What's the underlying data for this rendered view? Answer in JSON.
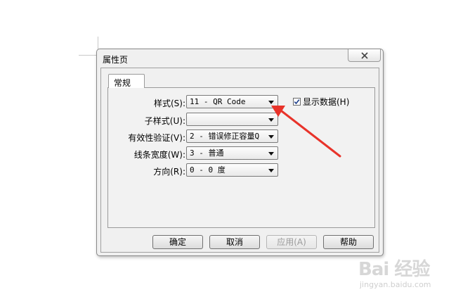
{
  "dialog": {
    "title": "属性页",
    "close_icon": "close-icon",
    "tab_label": "常规",
    "fields": [
      {
        "label": "样式(S):",
        "value": "11 - QR Code"
      },
      {
        "label": "子样式(U):",
        "value": ""
      },
      {
        "label": "有效性验证(V):",
        "value": "2 - 错误修正容量Q"
      },
      {
        "label": "线条宽度(W):",
        "value": "3 - 普通"
      },
      {
        "label": "方向(R):",
        "value": "0 - 0 度"
      }
    ],
    "checkbox": {
      "label": "显示数据(H)",
      "checked": true
    },
    "buttons": {
      "ok": "确定",
      "cancel": "取消",
      "apply": "应用(A)",
      "help": "帮助"
    }
  },
  "watermark": {
    "brand": "Bai 经验",
    "sub": "jingyan.baidu.com"
  },
  "colors": {
    "annotation_arrow": "#e8332a",
    "dialog_bg": "#f0f0f0"
  }
}
